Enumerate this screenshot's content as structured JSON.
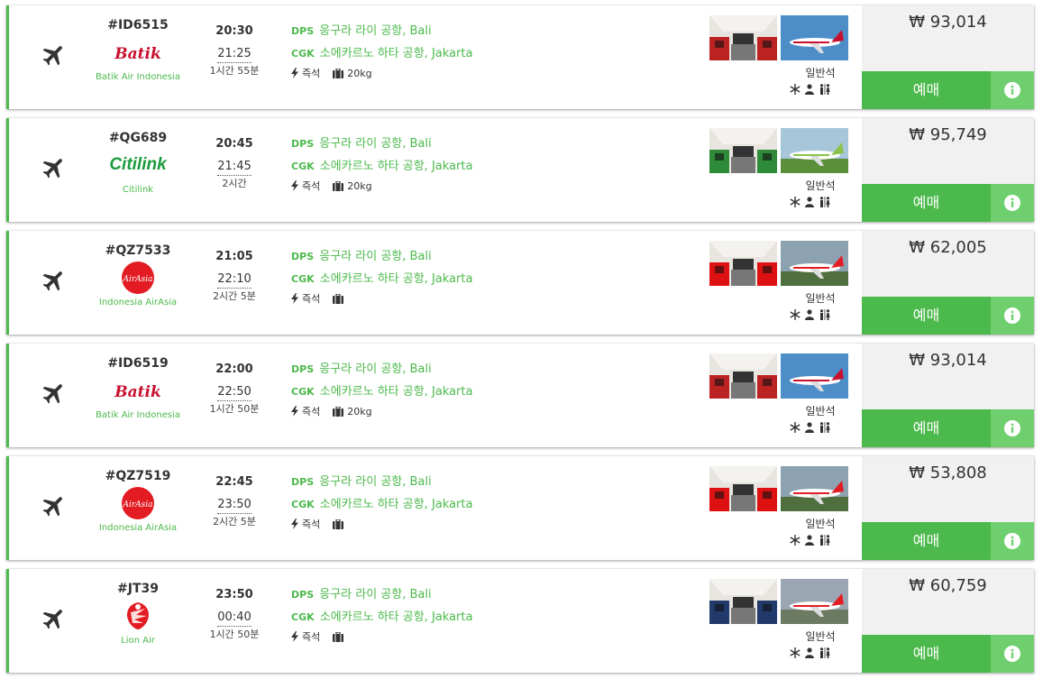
{
  "flights": [
    {
      "flight_no": "#ID6515",
      "airline": "Batik Air Indonesia",
      "logo": "batik",
      "dep": "20:30",
      "arr": "21:25",
      "duration": "1시간 55분",
      "from_code": "DPS",
      "from_name": "응구라 라이 공항, Bali",
      "to_code": "CGK",
      "to_name": "소에카르노 하타 공항, Jakarta",
      "seat": "즉석",
      "baggage": "20kg",
      "cabin_class": "일반석",
      "price": "₩ 93,014",
      "book_label": "예매",
      "photo": "batik"
    },
    {
      "flight_no": "#QG689",
      "airline": "Citilink",
      "logo": "citilink",
      "logo_text": "Citilink",
      "dep": "20:45",
      "arr": "21:45",
      "duration": "2시간",
      "from_code": "DPS",
      "from_name": "응구라 라이 공항, Bali",
      "to_code": "CGK",
      "to_name": "소에카르노 하타 공항, Jakarta",
      "seat": "즉석",
      "baggage": "20kg",
      "cabin_class": "일반석",
      "price": "₩ 95,749",
      "book_label": "예매",
      "photo": "citilink"
    },
    {
      "flight_no": "#QZ7533",
      "airline": "Indonesia AirAsia",
      "logo": "airasia",
      "dep": "21:05",
      "arr": "22:10",
      "duration": "2시간 5분",
      "from_code": "DPS",
      "from_name": "응구라 라이 공항, Bali",
      "to_code": "CGK",
      "to_name": "소에카르노 하타 공항, Jakarta",
      "seat": "즉석",
      "baggage": "",
      "cabin_class": "일반석",
      "price": "₩ 62,005",
      "book_label": "예매",
      "photo": "airasia"
    },
    {
      "flight_no": "#ID6519",
      "airline": "Batik Air Indonesia",
      "logo": "batik",
      "dep": "22:00",
      "arr": "22:50",
      "duration": "1시간 50분",
      "from_code": "DPS",
      "from_name": "응구라 라이 공항, Bali",
      "to_code": "CGK",
      "to_name": "소에카르노 하타 공항, Jakarta",
      "seat": "즉석",
      "baggage": "20kg",
      "cabin_class": "일반석",
      "price": "₩ 93,014",
      "book_label": "예매",
      "photo": "batik"
    },
    {
      "flight_no": "#QZ7519",
      "airline": "Indonesia AirAsia",
      "logo": "airasia",
      "dep": "22:45",
      "arr": "23:50",
      "duration": "2시간 5분",
      "from_code": "DPS",
      "from_name": "응구라 라이 공항, Bali",
      "to_code": "CGK",
      "to_name": "소에카르노 하타 공항, Jakarta",
      "seat": "즉석",
      "baggage": "",
      "cabin_class": "일반석",
      "price": "₩ 53,808",
      "book_label": "예매",
      "photo": "airasia"
    },
    {
      "flight_no": "#JT39",
      "airline": "Lion Air",
      "logo": "lion",
      "dep": "23:50",
      "arr": "00:40",
      "duration": "1시간 50분",
      "from_code": "DPS",
      "from_name": "응구라 라이 공항, Bali",
      "to_code": "CGK",
      "to_name": "소에카르노 하타 공항, Jakarta",
      "seat": "즉석",
      "baggage": "",
      "cabin_class": "일반석",
      "price": "₩ 60,759",
      "book_label": "예매",
      "photo": "lion"
    }
  ],
  "colors": {
    "accent": "#4cb94c",
    "accent_light": "#6fcf6f",
    "price_bg": "#f1f1f1",
    "batik_red": "#c8102e",
    "airasia_red": "#e31c23",
    "citilink_green": "#1a9b3c"
  },
  "icons": {
    "plane": "airplane-icon",
    "seat": "lightning-icon",
    "baggage": "suitcase-icon",
    "info": "info-icon",
    "amenities": [
      "snowflake-icon",
      "person-icon",
      "restroom-icon"
    ]
  }
}
